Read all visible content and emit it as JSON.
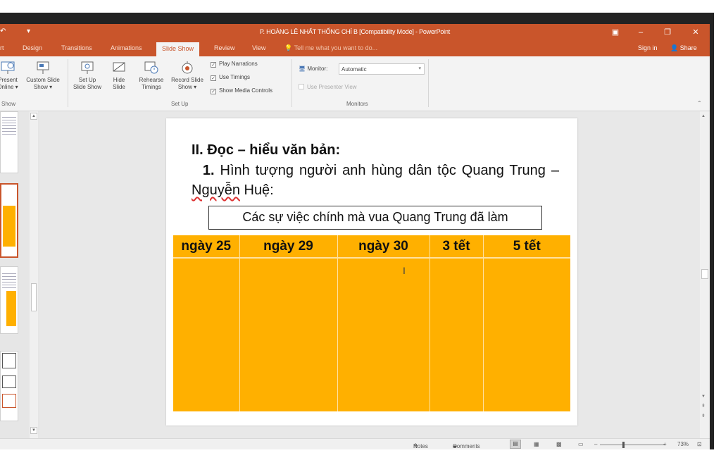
{
  "window": {
    "title": "P. HOÀNG LÊ NHẤT THỐNG CHÍ B [Compatibility Mode] - PowerPoint",
    "minimize": "–",
    "restore": "❐",
    "close": "✕",
    "ribbon_display": "▣"
  },
  "tabs": [
    {
      "label": "rt"
    },
    {
      "label": "Design"
    },
    {
      "label": "Transitions"
    },
    {
      "label": "Animations"
    },
    {
      "label": "Slide Show",
      "active": true
    },
    {
      "label": "Review"
    },
    {
      "label": "View"
    }
  ],
  "tell_me": "Tell me what you want to do...",
  "sign_in": "Sign in",
  "share": "Share",
  "ribbon": {
    "present_online": {
      "line1": "Present",
      "line2": "Online ▾"
    },
    "custom_show": {
      "line1": "Custom Slide",
      "line2": "Show ▾"
    },
    "start_group": "Show",
    "set_up": {
      "line1": "Set Up",
      "line2": "Slide Show"
    },
    "hide": {
      "line1": "Hide",
      "line2": "Slide"
    },
    "rehearse": {
      "line1": "Rehearse",
      "line2": "Timings"
    },
    "record": {
      "line1": "Record Slide",
      "line2": "Show ▾"
    },
    "play_narrations": "Play Narrations",
    "use_timings": "Use Timings",
    "show_media_controls": "Show Media Controls",
    "setup_group": "Set Up",
    "monitor_label": "Monitor:",
    "monitor_value": "Automatic",
    "use_presenter_view": "Use Presenter View",
    "monitors_group": "Monitors"
  },
  "slide": {
    "heading": "II. Đọc – hiểu văn bản:",
    "para_num": "1.",
    "para_text_a": " Hình tượng người anh hùng dân tộc Quang Trung – ",
    "para_text_b": "Nguyễn",
    "para_text_c": " Huệ:",
    "subtitle": "Các sự việc chính mà vua Quang Trung đã làm",
    "columns": [
      "ngày 25",
      "ngày 29",
      "ngày 30",
      "3 tết",
      "5 tết"
    ]
  },
  "status": {
    "notes": "Notes",
    "comments": "Comments",
    "zoom": "73%"
  },
  "colors": {
    "accent": "#c9552b",
    "table_fill": "#ffb000"
  }
}
